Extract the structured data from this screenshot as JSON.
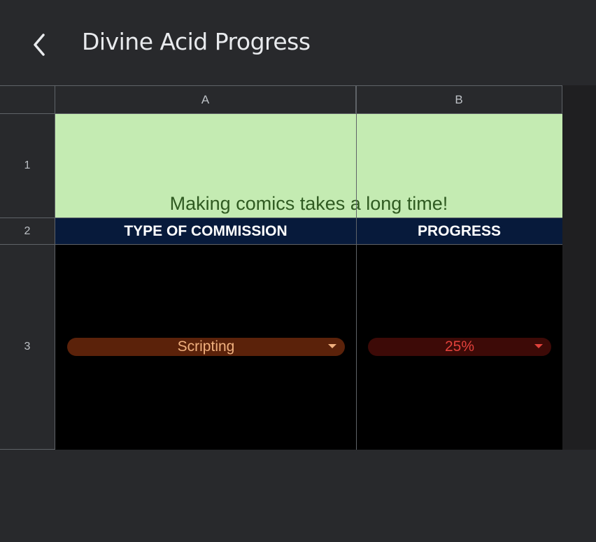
{
  "header": {
    "title": "Divine Acid Progress"
  },
  "columns": [
    "A",
    "B"
  ],
  "rows": [
    "1",
    "2",
    "3"
  ],
  "banner": {
    "text": "Making comics takes a long time!",
    "bg_color": "#c4ebb2",
    "text_color": "#2f5a21"
  },
  "table": {
    "headers": [
      "TYPE OF COMMISSION",
      "PROGRESS"
    ],
    "header_bg": "#071a3b",
    "row": {
      "type": {
        "value": "Scripting",
        "chip_bg": "#5b220a",
        "text_color": "#f0b07e"
      },
      "progress": {
        "value": "25%",
        "chip_bg": "#3d0a07",
        "text_color": "#e0413b"
      }
    }
  }
}
